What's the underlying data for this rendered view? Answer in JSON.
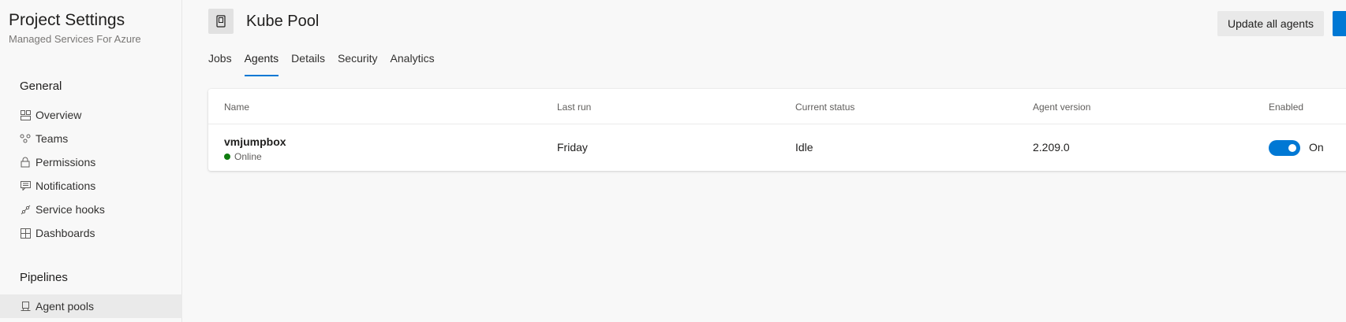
{
  "sidebar": {
    "title": "Project Settings",
    "subtitle": "Managed Services For Azure",
    "sections": [
      {
        "heading": "General"
      },
      {
        "heading": "Pipelines"
      }
    ],
    "general_items": [
      {
        "label": "Overview",
        "icon": "overview-icon"
      },
      {
        "label": "Teams",
        "icon": "teams-icon"
      },
      {
        "label": "Permissions",
        "icon": "lock-icon"
      },
      {
        "label": "Notifications",
        "icon": "notification-icon"
      },
      {
        "label": "Service hooks",
        "icon": "service-hooks-icon"
      },
      {
        "label": "Dashboards",
        "icon": "dashboard-icon"
      }
    ],
    "pipeline_items": [
      {
        "label": "Agent pools",
        "icon": "agent-pool-icon",
        "active": true
      }
    ]
  },
  "header": {
    "pool_name": "Kube Pool",
    "update_button": "Update all agents"
  },
  "tabs": [
    {
      "label": "Jobs"
    },
    {
      "label": "Agents",
      "active": true
    },
    {
      "label": "Details"
    },
    {
      "label": "Security"
    },
    {
      "label": "Analytics"
    }
  ],
  "table": {
    "columns": [
      "Name",
      "Last run",
      "Current status",
      "Agent version",
      "Enabled"
    ],
    "rows": [
      {
        "name": "vmjumpbox",
        "status": "Online",
        "last_run": "Friday",
        "current_status": "Idle",
        "agent_version": "2.209.0",
        "enabled_label": "On"
      }
    ]
  },
  "colors": {
    "accent": "#0078d4",
    "online": "#107c10"
  }
}
